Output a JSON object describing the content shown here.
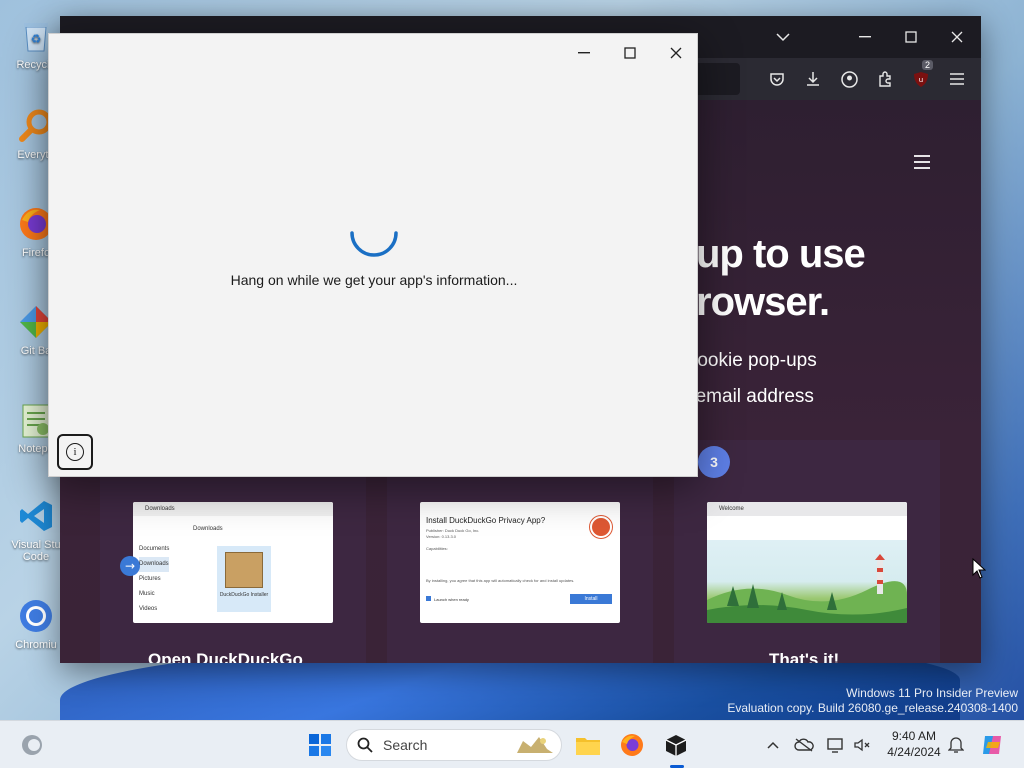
{
  "desktop": {
    "icons": [
      {
        "label": "Recycle",
        "icon": "recycle-bin-icon"
      },
      {
        "label": "Everyth",
        "icon": "everything-search-icon"
      },
      {
        "label": "Firefo",
        "icon": "firefox-icon"
      },
      {
        "label": "Git Ba",
        "icon": "git-bash-icon"
      },
      {
        "label": "Notepa",
        "icon": "notepad-icon"
      },
      {
        "label": "Visual Stu\nCode",
        "icon": "vscode-icon"
      },
      {
        "label": "Chromiu",
        "icon": "chromium-icon"
      }
    ]
  },
  "browser": {
    "hero": {
      "headline_line1": "up to use",
      "headline_line2": "rowser.",
      "sub1": "g cookie pop-ups",
      "sub2": "r email address"
    },
    "step_number": "3",
    "extension_badge": "2",
    "thumbs": [
      {
        "window_title": "Downloads",
        "path": "Downloads",
        "side_items": [
          "Documents",
          "Downloads",
          "Pictures",
          "Music",
          "Videos"
        ],
        "file_label": "DuckDuckGo Installer",
        "caption": "Open DuckDuckGo"
      },
      {
        "title": "Install DuckDuckGo Privacy App?",
        "publisher": "Publisher: Duck Duck Go, Inc.",
        "version": "Version: 0.13.3.0",
        "capabilities": "Capabilities:",
        "notice": "By installing, you agree that this app will automatically check for and install updates.",
        "launch_label": "Launch when ready",
        "install_label": "Install",
        "caption": ""
      },
      {
        "tab_title": "Welcome",
        "caption": "That's it!"
      }
    ]
  },
  "dialog": {
    "loading_text": "Hang on while we get your app's information...",
    "info_glyph": "i"
  },
  "watermark": {
    "line1": "Windows 11 Pro Insider Preview",
    "line2": "Evaluation copy. Build 26080.ge_release.240308-1400"
  },
  "taskbar": {
    "search_label": "Search",
    "time": "9:40 AM",
    "date": "4/24/2024"
  },
  "colors": {
    "accent": "#0a5bd3",
    "spinner": "#1a6fc4",
    "page_bg": "#2e1f31",
    "step_circle": "#5e7fe6"
  }
}
